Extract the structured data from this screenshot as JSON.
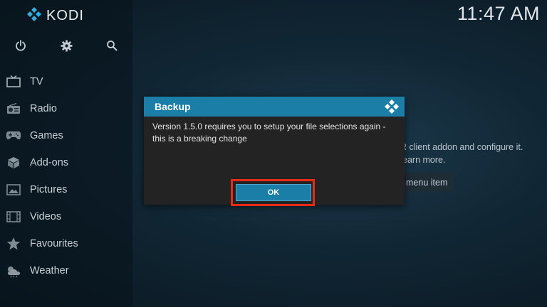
{
  "app": {
    "name": "KODI",
    "clock": "11:47 AM"
  },
  "top_icons": [
    {
      "icon": "power-icon"
    },
    {
      "icon": "gear-icon"
    },
    {
      "icon": "search-icon"
    }
  ],
  "sidebar": {
    "items": [
      {
        "label": "TV",
        "icon": "tv-icon"
      },
      {
        "label": "Radio",
        "icon": "radio-icon"
      },
      {
        "label": "Games",
        "icon": "gamepad-icon"
      },
      {
        "label": "Add-ons",
        "icon": "box-icon"
      },
      {
        "label": "Pictures",
        "icon": "picture-icon"
      },
      {
        "label": "Videos",
        "icon": "film-icon"
      },
      {
        "label": "Favourites",
        "icon": "star-icon"
      },
      {
        "label": "Weather",
        "icon": "weather-icon"
      }
    ]
  },
  "background": {
    "line1": "R client addon and configure it.",
    "line2": "earn more.",
    "button": "menu item"
  },
  "dialog": {
    "title": "Backup",
    "message": "Version 1.5.0 requires you to setup your file selections again - this is a breaking change",
    "ok_label": "OK"
  },
  "colors": {
    "accent": "#1b7ea6",
    "highlight": "#ea2a15",
    "dialog_bg": "#232323"
  }
}
